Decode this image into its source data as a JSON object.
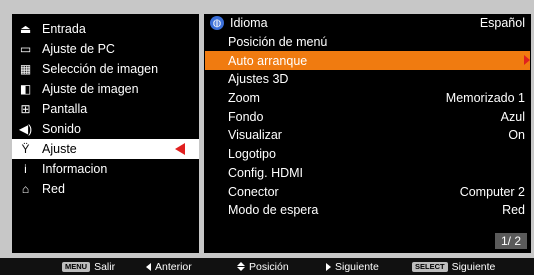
{
  "sidebar": {
    "items": [
      {
        "label": "Entrada",
        "icon": "input-icon",
        "glyph": "⏏"
      },
      {
        "label": "Ajuste de PC",
        "icon": "pc-adjust-icon",
        "glyph": "▭"
      },
      {
        "label": "Selección de imagen",
        "icon": "image-select-icon",
        "glyph": "▦"
      },
      {
        "label": "Ajuste de imagen",
        "icon": "image-adjust-icon",
        "glyph": "◧"
      },
      {
        "label": "Pantalla",
        "icon": "screen-icon",
        "glyph": "⊞"
      },
      {
        "label": "Sonido",
        "icon": "sound-icon",
        "glyph": "◀)"
      },
      {
        "label": "Ajuste",
        "icon": "setting-icon",
        "glyph": "Ÿ",
        "selected": true
      },
      {
        "label": "Informacion",
        "icon": "info-icon",
        "glyph": "i"
      },
      {
        "label": "Red",
        "icon": "network-icon",
        "glyph": "⌂"
      }
    ]
  },
  "menu": {
    "rows": [
      {
        "label": "Idioma",
        "value": "Español"
      },
      {
        "label": "Posición de menú",
        "value": ""
      },
      {
        "label": "Auto arranque",
        "value": "",
        "highlight": true
      },
      {
        "label": "Ajustes 3D",
        "value": ""
      },
      {
        "label": "Zoom",
        "value": "Memorizado 1"
      },
      {
        "label": "Fondo",
        "value": "Azul"
      },
      {
        "label": "Visualizar",
        "value": "On"
      },
      {
        "label": "Logotipo",
        "value": ""
      },
      {
        "label": "Config. HDMI",
        "value": ""
      },
      {
        "label": "Conector",
        "value": "Computer 2"
      },
      {
        "label": "Modo de espera",
        "value": "Red"
      }
    ],
    "page": "1/ 2"
  },
  "footer": {
    "menu_key": "MENU",
    "salir": "Salir",
    "anterior": "Anterior",
    "posicion": "Posición",
    "siguiente1": "Siguiente",
    "select_key": "SELECT",
    "siguiente2": "Siguiente"
  },
  "colors": {
    "highlight": "#f07b10",
    "arrow": "#e0201f",
    "panel": "#000000",
    "background": "#c7c7c7"
  }
}
